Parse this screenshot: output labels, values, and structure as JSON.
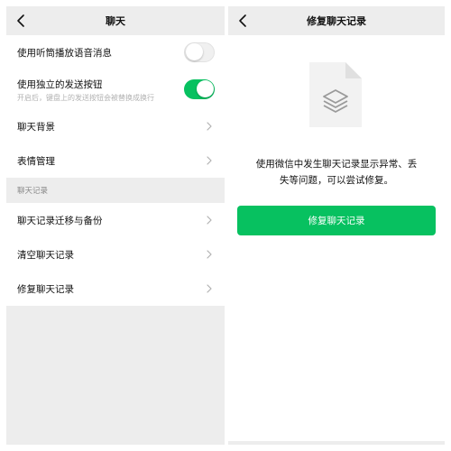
{
  "colors": {
    "accent": "#07c160",
    "background": "#ededed",
    "card": "#ffffff",
    "secondary_text": "#b2b2b2"
  },
  "left": {
    "title": "聊天",
    "back_icon": "chevron-left-icon",
    "settings": [
      {
        "label": "使用听筒播放语音消息",
        "control": "toggle",
        "state": "off"
      },
      {
        "label": "使用独立的发送按钮",
        "sublabel": "开启后，键盘上的发送按钮会被替换成换行",
        "control": "toggle",
        "state": "on"
      },
      {
        "label": "聊天背景",
        "control": "chevron"
      },
      {
        "label": "表情管理",
        "control": "chevron"
      }
    ],
    "section_title": "聊天记录",
    "records": [
      {
        "label": "聊天记录迁移与备份"
      },
      {
        "label": "清空聊天记录"
      },
      {
        "label": "修复聊天记录"
      }
    ]
  },
  "right": {
    "title": "修复聊天记录",
    "back_icon": "chevron-left-icon",
    "illustration": "document-layers-icon",
    "description_line1": "使用微信中发生聊天记录显示异常、丢",
    "description_line2": "失等问题，可以尝试修复。",
    "button_label": "修复聊天记录"
  }
}
